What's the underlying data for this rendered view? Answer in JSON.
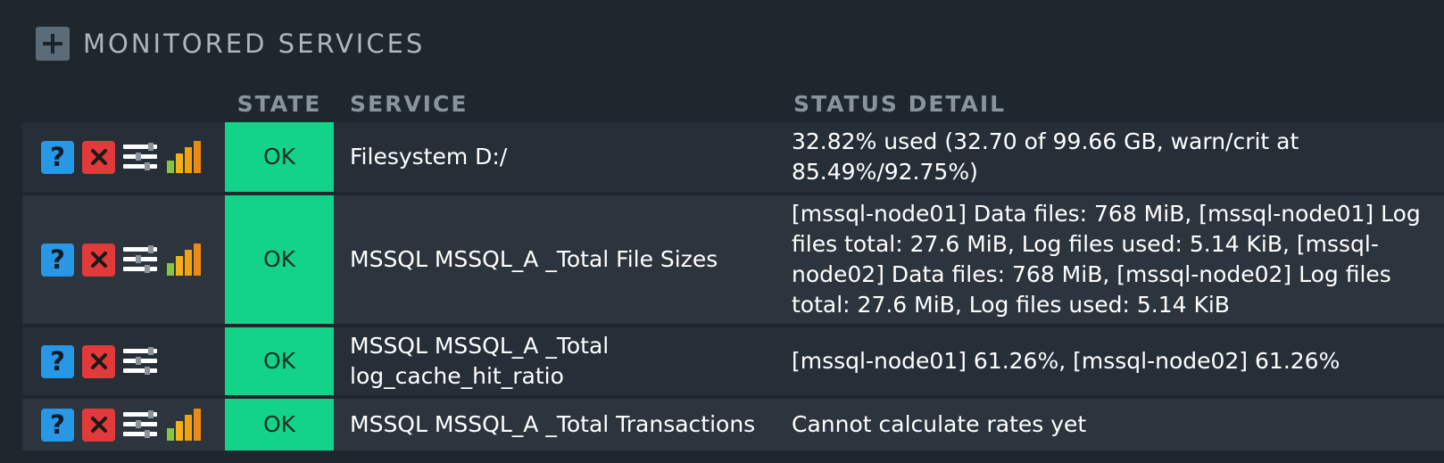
{
  "section": {
    "title": "MONITORED SERVICES",
    "toggle_icon": "plus-icon"
  },
  "table": {
    "columns": {
      "icons": "",
      "state": "STATE",
      "service": "SERVICE",
      "status_detail": "STATUS DETAIL"
    },
    "rows": [
      {
        "state": "OK",
        "service": "Filesystem D:/",
        "status_detail": "32.82% used (32.70 of 99.66 GB, warn/crit at 85.49%/92.75%)",
        "icons": [
          "help-icon",
          "close-icon",
          "menu-icon",
          "graph-icon"
        ]
      },
      {
        "state": "OK",
        "service": "MSSQL MSSQL_A _Total File Sizes",
        "status_detail": "[mssql-node01] Data files: 768 MiB, [mssql-node01] Log files total: 27.6 MiB, Log files used: 5.14 KiB, [mssql-node02] Data files: 768 MiB, [mssql-node02] Log files total: 27.6 MiB, Log files used: 5.14 KiB",
        "icons": [
          "help-icon",
          "close-icon",
          "menu-icon",
          "graph-icon"
        ]
      },
      {
        "state": "OK",
        "service": "MSSQL MSSQL_A _Total log_cache_hit_ratio",
        "status_detail": "[mssql-node01] 61.26%, [mssql-node02] 61.26%",
        "icons": [
          "help-icon",
          "close-icon",
          "menu-icon"
        ]
      },
      {
        "state": "OK",
        "service": "MSSQL MSSQL_A _Total Transactions",
        "status_detail": "Cannot calculate rates yet",
        "icons": [
          "help-icon",
          "close-icon",
          "menu-icon",
          "graph-icon"
        ]
      }
    ]
  },
  "colors": {
    "background": "#1e262e",
    "row_odd": "#262f38",
    "row_even": "#2c353e",
    "state_ok": "#13d389",
    "help_icon": "#2797e6",
    "close_icon": "#e23a3a",
    "header_text": "#8a949c"
  },
  "glyphs": {
    "help": "?"
  }
}
